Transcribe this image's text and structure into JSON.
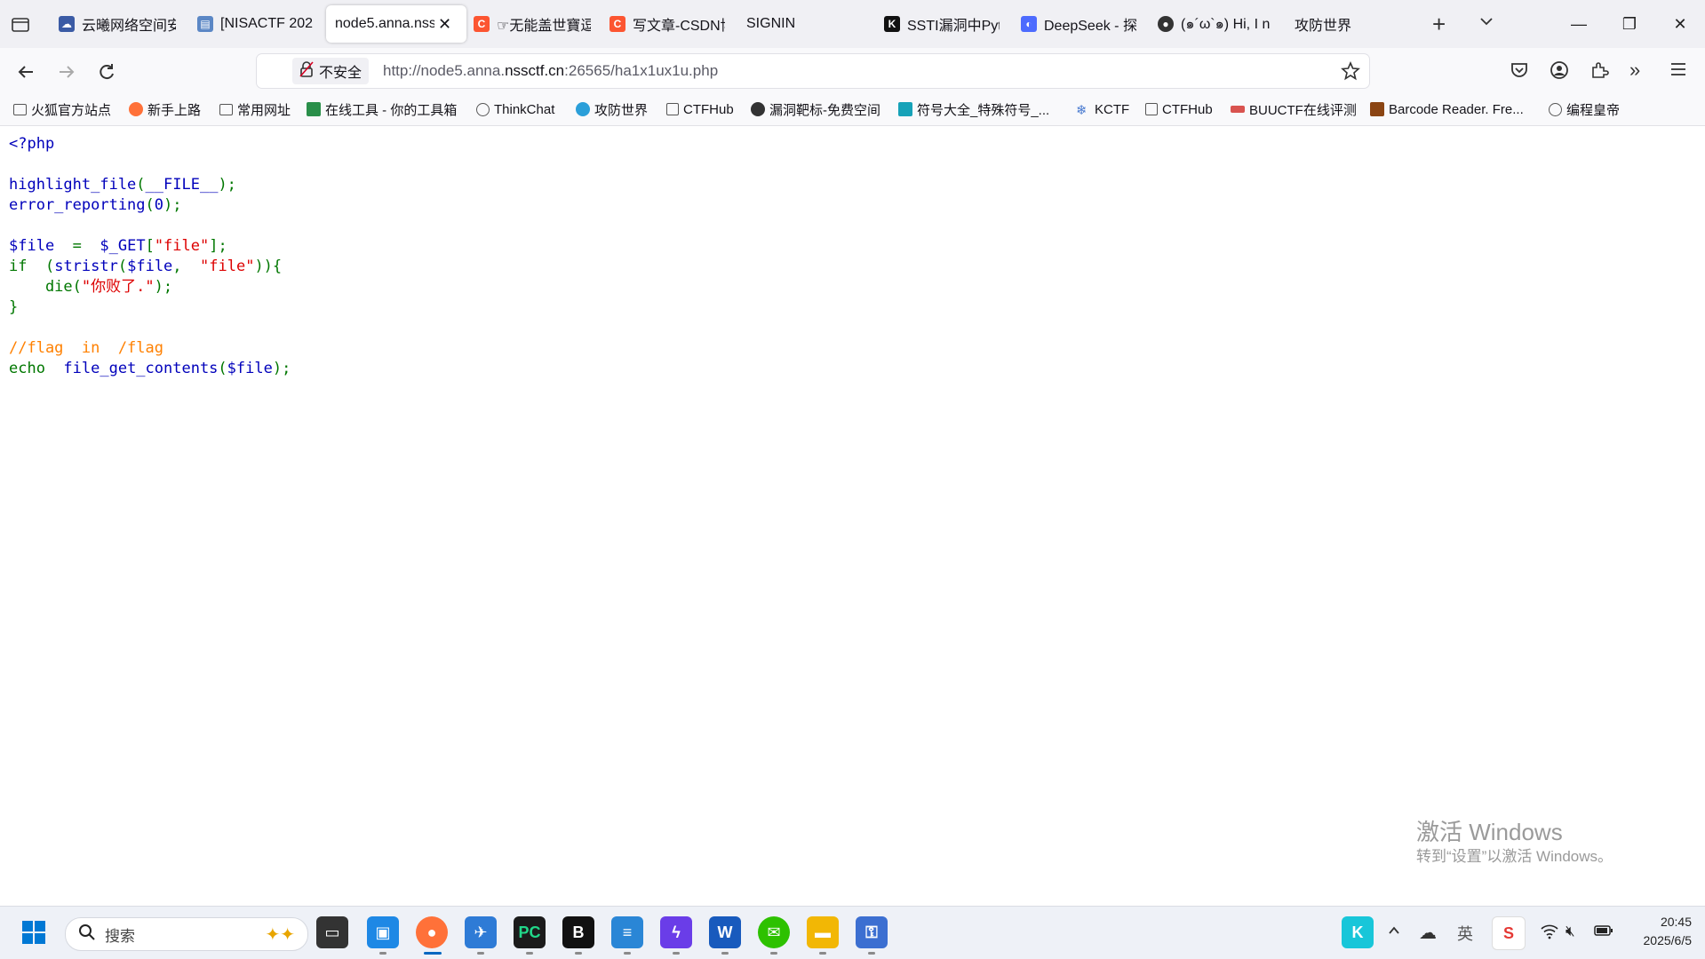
{
  "tabs": [
    {
      "title": "云曦网络空间安",
      "icon": "cloud-icon",
      "color": "#3b5ba5"
    },
    {
      "title": "[NISACTF 202",
      "icon": "page-icon",
      "color": "#5b87c5"
    },
    {
      "title": "node5.anna.nss",
      "icon": "",
      "color": "",
      "active": true
    },
    {
      "title": "☞无能盖世寶逗",
      "icon": "csdn-icon",
      "color": "#fc5531"
    },
    {
      "title": "写文章-CSDN博",
      "icon": "csdn-icon",
      "color": "#fc5531"
    },
    {
      "title": "SIGNIN",
      "icon": "",
      "color": ""
    },
    {
      "title": "SSTI漏洞中Pyt",
      "icon": "k-icon",
      "color": "#111111"
    },
    {
      "title": "DeepSeek - 探",
      "icon": "deepseek-icon",
      "color": "#4d6bfe"
    },
    {
      "title": "(๑´ω`๑) Hi, I n",
      "icon": "avatar-icon",
      "color": "#333333"
    },
    {
      "title": "攻防世界",
      "icon": "",
      "color": ""
    }
  ],
  "nav": {
    "security_label": "不安全",
    "url_prefix": "http://node5.anna.",
    "url_domain": "nssctf.cn",
    "url_suffix": ":26565/ha1x1ux1u.php"
  },
  "bookmarks": [
    {
      "label": "火狐官方站点",
      "icon": "folder-icon",
      "color": "#555555"
    },
    {
      "label": "新手上路",
      "icon": "firefox-icon",
      "color": "#ff7139"
    },
    {
      "label": "常用网址",
      "icon": "folder-icon",
      "color": "#555555"
    },
    {
      "label": "在线工具 - 你的工具箱",
      "icon": "tool-icon",
      "color": "#2a8f4a"
    },
    {
      "label": "ThinkChat",
      "icon": "globe-icon",
      "color": "#555555"
    },
    {
      "label": "攻防世界",
      "icon": "adworld-icon",
      "color": "#2b9fd9"
    },
    {
      "label": "CTFHub",
      "icon": "cube-icon",
      "color": "#555555"
    },
    {
      "label": "漏洞靶标-免费空间",
      "icon": "target-icon",
      "color": "#333333"
    },
    {
      "label": "符号大全_特殊符号_...",
      "icon": "ke-icon",
      "color": "#17a2b8"
    },
    {
      "label": "KCTF",
      "icon": "snowflake-icon",
      "color": "#4a7bd0"
    },
    {
      "label": "CTFHub",
      "icon": "cube-icon",
      "color": "#555555"
    },
    {
      "label": "BUUCTF在线评测",
      "icon": "buu-icon",
      "color": "#d9534f"
    },
    {
      "label": "Barcode Reader. Fre...",
      "icon": "barcode-icon",
      "color": "#8b4513"
    },
    {
      "label": "编程皇帝",
      "icon": "globe-icon",
      "color": "#555555"
    }
  ],
  "code": {
    "l1": "<?php",
    "l3a": "highlight_file",
    "l3b": "(",
    "l3c": "__FILE__",
    "l3d": ");",
    "l4a": "error_reporting",
    "l4b": "(",
    "l4c": "0",
    "l4d": ");",
    "l6a": "$file  ",
    "l6b": "=  ",
    "l6c": "$_GET",
    "l6d": "[",
    "l6e": "\"file\"",
    "l6f": "];",
    "l7a": "if  ",
    "l7b": "(",
    "l7c": "stristr",
    "l7d": "(",
    "l7e": "$file",
    "l7f": ",  ",
    "l7g": "\"file\"",
    "l7h": ")){",
    "l8a": "    die",
    "l8b": "(",
    "l8c": "\"你败了.\"",
    "l8d": ");",
    "l9": "}",
    "l11": "//flag  in  /flag",
    "l12a": "echo  ",
    "l12b": "file_get_contents",
    "l12c": "(",
    "l12d": "$file",
    "l12e": ");"
  },
  "watermark": {
    "title": "激活 Windows",
    "subtitle": "转到“设置”以激活 Windows。"
  },
  "taskbar": {
    "search_placeholder": "搜索",
    "time": "20:45",
    "date": "2025/6/5"
  }
}
